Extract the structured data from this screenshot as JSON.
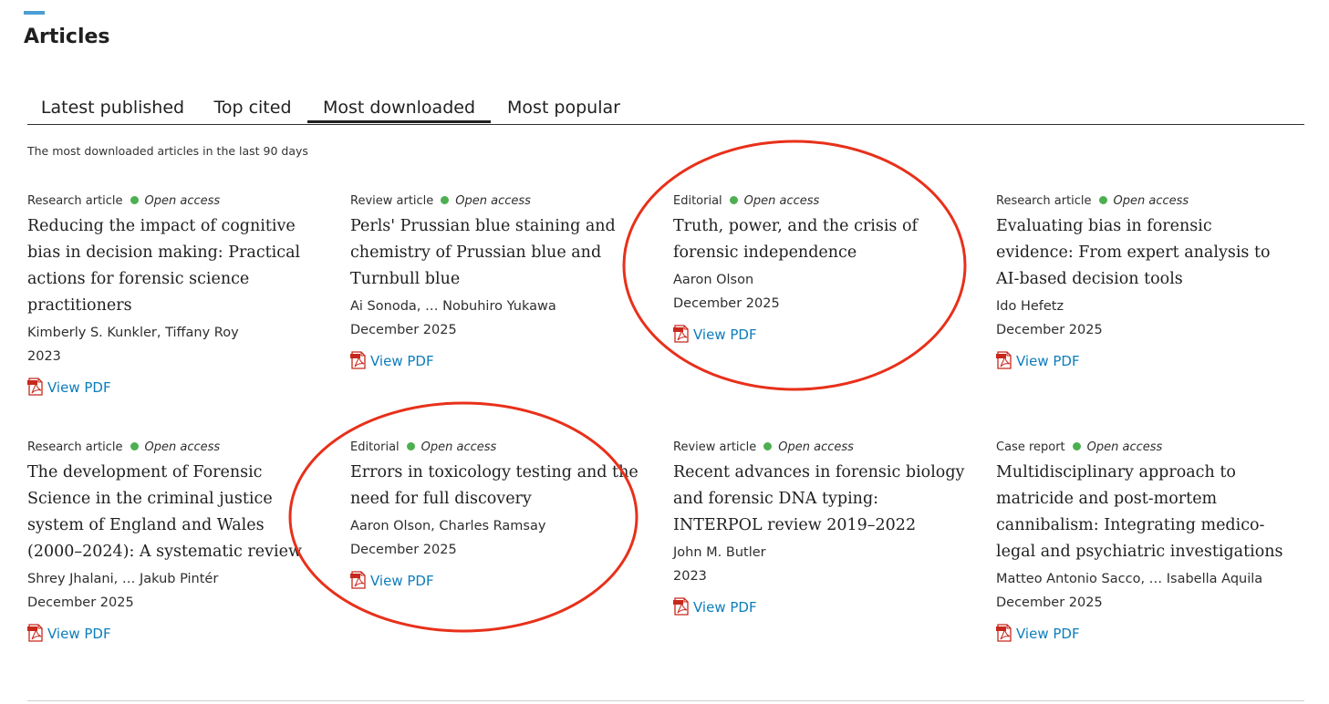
{
  "header": {
    "title": "Articles"
  },
  "tabs": [
    {
      "label": "Latest published"
    },
    {
      "label": "Top cited"
    },
    {
      "label": "Most downloaded"
    },
    {
      "label": "Most popular"
    }
  ],
  "active_tab_index": 2,
  "tab_description": "The most downloaded articles in the last 90 days",
  "open_access_color": "#4caf50",
  "link_color": "#0c7dbb",
  "annotation_color": "#e8301a",
  "articles": [
    {
      "type": "Research article",
      "access": "Open access",
      "title": "Reducing the impact of cognitive bias in decision making: Practical actions for forensic science practitioners",
      "authors": "Kimberly S. Kunkler, Tiffany Roy",
      "date": "2023",
      "pdf_label": "View PDF"
    },
    {
      "type": "Review article",
      "access": "Open access",
      "title": "Perls' Prussian blue staining and chemistry of Prussian blue and Turnbull blue",
      "authors": "Ai Sonoda, … Nobuhiro Yukawa",
      "date": "December 2025",
      "pdf_label": "View PDF"
    },
    {
      "type": "Editorial",
      "access": "Open access",
      "title": "Truth, power, and the crisis of forensic independence",
      "authors": "Aaron Olson",
      "date": "December 2025",
      "pdf_label": "View PDF"
    },
    {
      "type": "Research article",
      "access": "Open access",
      "title": "Evaluating bias in forensic evidence: From expert analysis to AI-based decision tools",
      "authors": "Ido Hefetz",
      "date": "December 2025",
      "pdf_label": "View PDF"
    },
    {
      "type": "Research article",
      "access": "Open access",
      "title": "The development of Forensic Science in the criminal justice system of England and Wales (2000–2024): A systematic review",
      "authors": "Shrey Jhalani, … Jakub Pintér",
      "date": "December 2025",
      "pdf_label": "View PDF"
    },
    {
      "type": "Editorial",
      "access": "Open access",
      "title": "Errors in toxicology testing and the need for full discovery",
      "authors": "Aaron Olson, Charles Ramsay",
      "date": "December 2025",
      "pdf_label": "View PDF"
    },
    {
      "type": "Review article",
      "access": "Open access",
      "title": "Recent advances in forensic biology and forensic DNA typing: INTERPOL review 2019–2022",
      "authors": "John M. Butler",
      "date": "2023",
      "pdf_label": "View PDF"
    },
    {
      "type": "Case report",
      "access": "Open access",
      "title": "Multidisciplinary approach to matricide and post-mortem cannibalism: Integrating medico-legal and psychiatric investigations",
      "authors": "Matteo Antonio Sacco, … Isabella Aquila",
      "date": "December 2025",
      "pdf_label": "View PDF"
    }
  ],
  "icons": {
    "pdf": "pdf-file-icon",
    "open_access": "open-access-dot-icon"
  }
}
